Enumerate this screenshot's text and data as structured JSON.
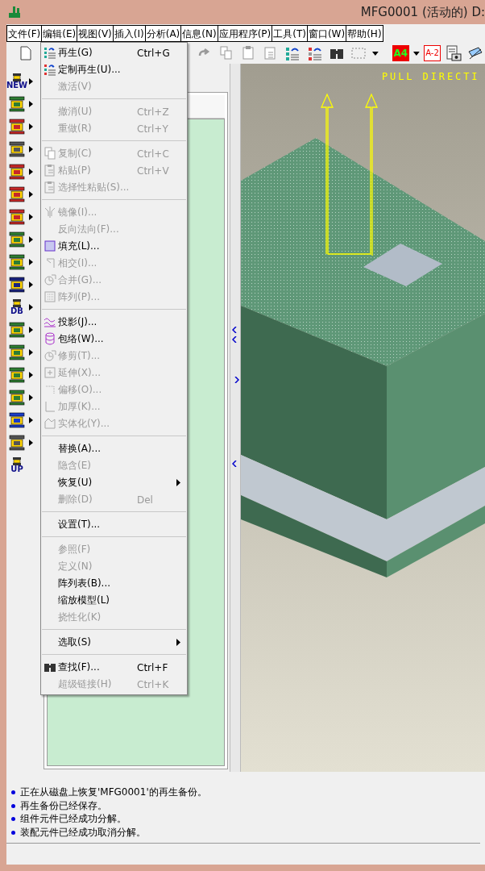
{
  "window": {
    "title": "MFG0001 (活动的) D:"
  },
  "menu_bar": [
    "文件(F)",
    "编辑(E)",
    "视图(V)",
    "插入(I)",
    "分析(A)",
    "信息(N)",
    "应用程序(P)",
    "工具(T)",
    "窗口(W)",
    "帮助(H)"
  ],
  "toolbar": {
    "text_buttons": [
      "A4",
      "A-2"
    ]
  },
  "side_toolbar": [
    {
      "submenu": true,
      "text": "NEW"
    },
    {
      "submenu": true
    },
    {
      "submenu": true
    },
    {
      "submenu": true
    },
    {
      "submenu": true
    },
    {
      "submenu": true
    },
    {
      "submenu": true
    },
    {
      "submenu": true
    },
    {
      "submenu": true
    },
    {
      "submenu": true
    },
    {
      "submenu": true,
      "text": "DB"
    },
    {
      "submenu": true
    },
    {
      "submenu": true
    },
    {
      "submenu": true
    },
    {
      "submenu": true
    },
    {
      "submenu": true
    },
    {
      "submenu": true
    },
    {
      "submenu": false,
      "text": "UP"
    }
  ],
  "edit_menu": [
    {
      "kind": "item",
      "label": "再生(G)",
      "shortcut": "Ctrl+G",
      "disabled": false
    },
    {
      "kind": "item",
      "label": "定制再生(U)...",
      "disabled": false
    },
    {
      "kind": "item",
      "label": "激活(V)",
      "disabled": true
    },
    {
      "kind": "separator"
    },
    {
      "kind": "item",
      "label": "撤消(U)",
      "shortcut": "Ctrl+Z",
      "disabled": true
    },
    {
      "kind": "item",
      "label": "重做(R)",
      "shortcut": "Ctrl+Y",
      "disabled": true
    },
    {
      "kind": "separator"
    },
    {
      "kind": "item",
      "label": "复制(C)",
      "shortcut": "Ctrl+C",
      "disabled": true
    },
    {
      "kind": "item",
      "label": "粘贴(P)",
      "shortcut": "Ctrl+V",
      "disabled": true
    },
    {
      "kind": "item",
      "label": "选择性粘贴(S)...",
      "disabled": true
    },
    {
      "kind": "separator"
    },
    {
      "kind": "item",
      "label": "镜像(I)...",
      "disabled": true
    },
    {
      "kind": "item",
      "label": "反向法向(F)...",
      "disabled": true
    },
    {
      "kind": "item",
      "label": "填充(L)...",
      "disabled": false
    },
    {
      "kind": "item",
      "label": "相交(I)...",
      "disabled": true
    },
    {
      "kind": "item",
      "label": "合并(G)...",
      "disabled": true
    },
    {
      "kind": "item",
      "label": "阵列(P)...",
      "disabled": true
    },
    {
      "kind": "separator"
    },
    {
      "kind": "item",
      "label": "投影(J)...",
      "disabled": false
    },
    {
      "kind": "item",
      "label": "包络(W)...",
      "disabled": false
    },
    {
      "kind": "item",
      "label": "修剪(T)...",
      "disabled": true
    },
    {
      "kind": "item",
      "label": "延伸(X)...",
      "disabled": true
    },
    {
      "kind": "item",
      "label": "偏移(O)...",
      "disabled": true
    },
    {
      "kind": "item",
      "label": "加厚(K)...",
      "disabled": true
    },
    {
      "kind": "item",
      "label": "实体化(Y)...",
      "disabled": true
    },
    {
      "kind": "separator"
    },
    {
      "kind": "item",
      "label": "替换(A)...",
      "disabled": false
    },
    {
      "kind": "item",
      "label": "隐含(E)",
      "disabled": true
    },
    {
      "kind": "item",
      "label": "恢复(U)",
      "disabled": false,
      "submenu": true
    },
    {
      "kind": "item",
      "label": "删除(D)",
      "shortcut": "Del",
      "disabled": true
    },
    {
      "kind": "separator"
    },
    {
      "kind": "item",
      "label": "设置(T)...",
      "disabled": false
    },
    {
      "kind": "separator"
    },
    {
      "kind": "item",
      "label": "参照(F)",
      "disabled": true
    },
    {
      "kind": "item",
      "label": "定义(N)",
      "disabled": true
    },
    {
      "kind": "item",
      "label": "阵列表(B)...",
      "disabled": false
    },
    {
      "kind": "item",
      "label": "缩放模型(L)",
      "disabled": false
    },
    {
      "kind": "item",
      "label": "挠性化(K)",
      "disabled": true
    },
    {
      "kind": "separator"
    },
    {
      "kind": "item",
      "label": "选取(S)",
      "disabled": false,
      "submenu": true
    },
    {
      "kind": "separator"
    },
    {
      "kind": "item",
      "label": "查找(F)...",
      "shortcut": "Ctrl+F",
      "disabled": false
    },
    {
      "kind": "item",
      "label": "超级链接(H)",
      "shortcut": "Ctrl+K",
      "disabled": true
    }
  ],
  "viewport": {
    "label": "PULL DIRECTI"
  },
  "messages": [
    "正在从磁盘上恢复'MFG0001'的再生备份。",
    "再生备份已经保存。",
    "组件元件已经成功分解。",
    "装配元件已经成功取消分解。"
  ]
}
